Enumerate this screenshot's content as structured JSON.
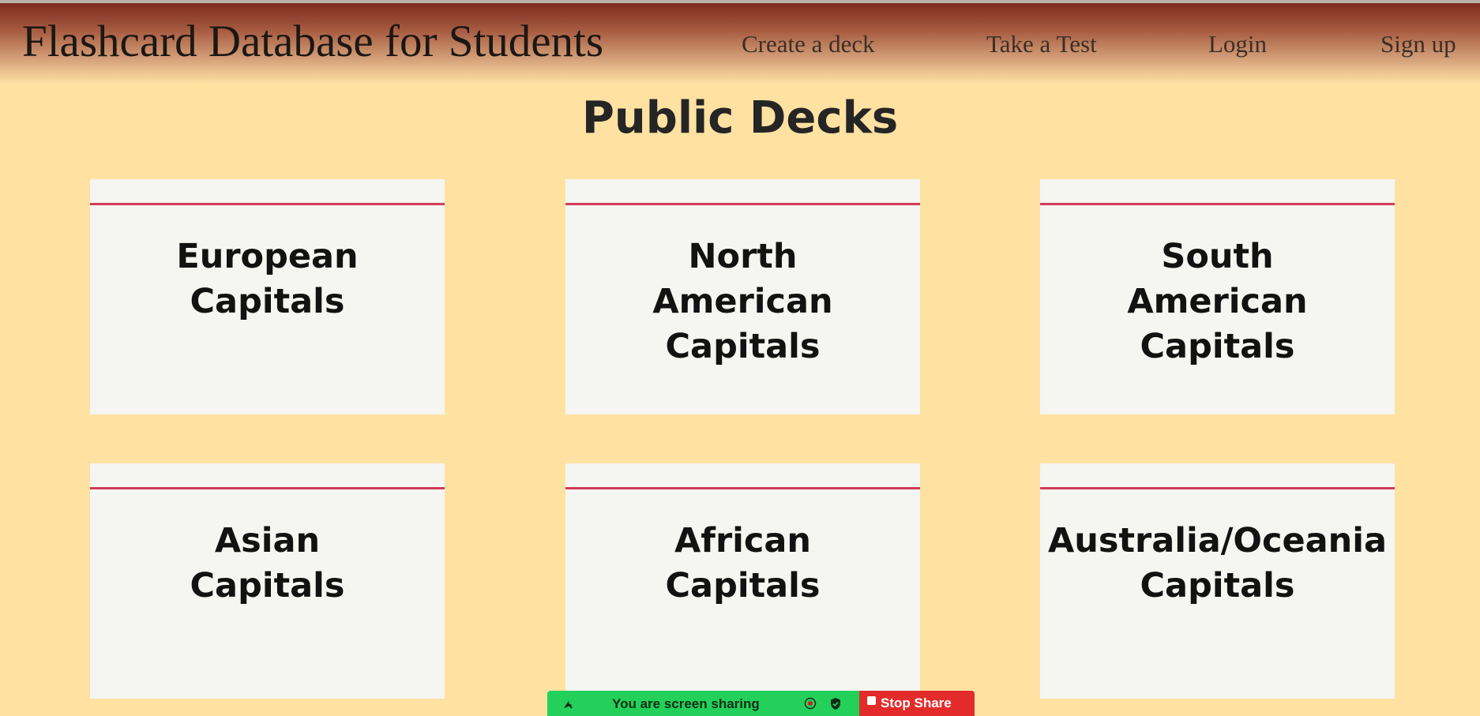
{
  "header": {
    "brand": "Flashcard Database for Students",
    "nav": {
      "create_deck": "Create a deck",
      "take_test": "Take a Test",
      "login": "Login",
      "signup": "Sign up"
    }
  },
  "main": {
    "title": "Public Decks",
    "decks": [
      {
        "label": "European\nCapitals"
      },
      {
        "label": "North\nAmerican\nCapitals"
      },
      {
        "label": "South\nAmerican\nCapitals"
      },
      {
        "label": "Asian\nCapitals"
      },
      {
        "label": "African\nCapitals"
      },
      {
        "label": "Australia/Oceania\nCapitals"
      }
    ]
  },
  "share_bar": {
    "status": "You are screen sharing",
    "stop_label": "Stop Share",
    "icons": [
      "pointer-icon",
      "recording-icon",
      "shield-icon",
      "stop-icon"
    ],
    "colors": {
      "green": "#23d15a",
      "red": "#e32b2b"
    }
  },
  "colors": {
    "page_background": "#ffe1a2",
    "navbar_top": "#7e2a1f",
    "card_red_line": "#d43b5a",
    "card_blue_line": "#8fcbe0"
  }
}
